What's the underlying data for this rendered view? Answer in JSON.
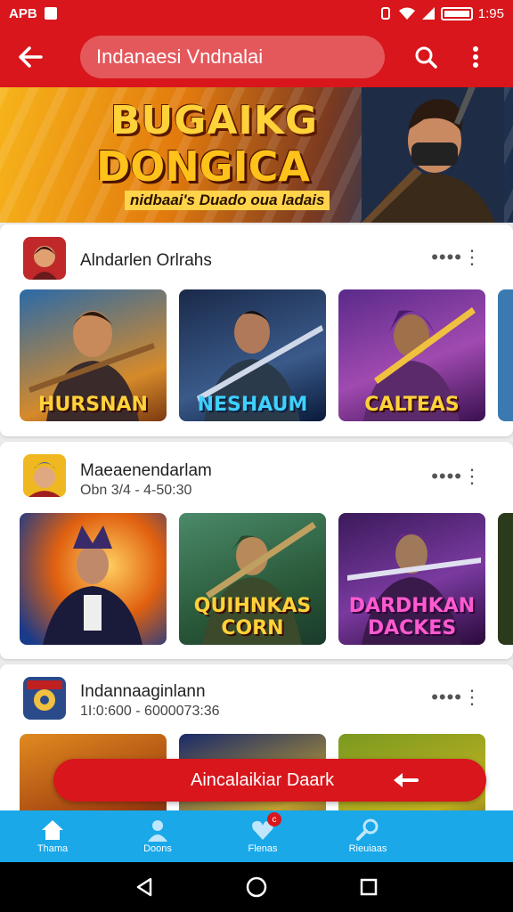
{
  "status_bar": {
    "left_text": "APB",
    "time": "1:95"
  },
  "app_bar": {
    "search_text": "Indanaesi Vndnalai"
  },
  "banner": {
    "title_line1": "BUGAIKG",
    "title_line2": "DONGICA",
    "tagline": "nidbaai's Duado oua ladais"
  },
  "sections": [
    {
      "title": "Alndarlen Orlrahs",
      "subtitle": "",
      "thumbs": [
        {
          "caption": "HURSNAN"
        },
        {
          "caption": "NESHAUM"
        },
        {
          "caption": "CALTEAS"
        }
      ]
    },
    {
      "title": "Maeaenendarlam",
      "subtitle": "Obn 3/4 - 4-50:30",
      "thumbs": [
        {
          "caption": ""
        },
        {
          "caption": "QUIHNKAS CORN"
        },
        {
          "caption": "DARDHKAN DACKES"
        }
      ]
    },
    {
      "title": "Indannaaginlann",
      "subtitle": "1I:0:600 - 6000073:36",
      "thumbs": [
        {
          "caption": ""
        },
        {
          "caption": ""
        },
        {
          "caption": ""
        }
      ]
    }
  ],
  "cta": {
    "label": "Aincalaikiar Daark"
  },
  "bottom_nav": [
    {
      "label": "Thama",
      "icon": "home-icon"
    },
    {
      "label": "Doons",
      "icon": "person-icon"
    },
    {
      "label": "Flenas",
      "icon": "heart-icon",
      "badge": "c"
    },
    {
      "label": "Rieuiaas",
      "icon": "search-icon"
    }
  ],
  "colors": {
    "primary": "#d8161c",
    "nav": "#1aa8e8"
  }
}
